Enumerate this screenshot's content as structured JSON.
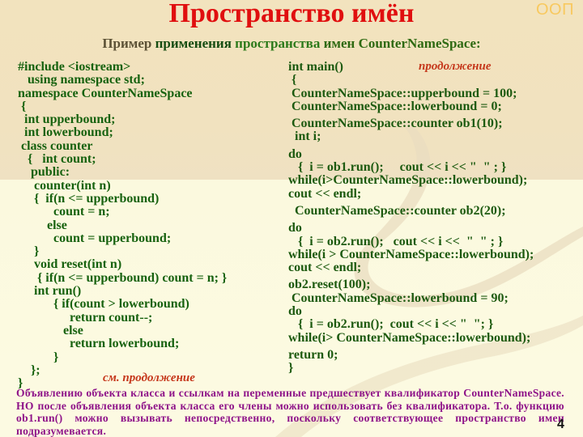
{
  "header": {
    "tag": "ООП",
    "title": "Пространство имён",
    "subtitle": {
      "part1": "Пример ",
      "part2": "применения ",
      "part3": "пространства ",
      "part4": "имен CounterNameSpace:"
    }
  },
  "colors": {
    "title": "#e00f0f",
    "code": "#17620f",
    "continuation": "#c5361a",
    "note": "#8e1389",
    "tag": "#f8c95f",
    "background_top": "#f2e3be",
    "background_bottom": "#fbf9de"
  },
  "left_code": {
    "lines": [
      "#include <iostream>",
      "   using namespace std;",
      "namespace CounterNameSpace",
      " {",
      "  int upperbound;",
      "  int lowerbound;",
      " class counter",
      "   {   int count;",
      "    public:",
      "     counter(int n)",
      "     {  if(n <= upperbound)",
      "           count = n;",
      "         else",
      "           count = upperbound;",
      "     }",
      "     void reset(int n)",
      "      { if(n <= upperbound) count = n; }",
      "     int run()",
      "           { if(count > lowerbound)",
      "                return count--;",
      "              else",
      "                return lowerbound;",
      "           }",
      "    };",
      "}"
    ],
    "continuation": "см. продолжение"
  },
  "right_code": {
    "continuation": "продолжение",
    "groups": [
      [
        "int main()",
        " {",
        " CounterNameSpace::upperbound = 100;",
        " CounterNameSpace::lowerbound = 0;"
      ],
      [
        " CounterNameSpace::counter ob1(10);",
        "  int i;"
      ],
      [
        "do",
        "   {  i = ob1.run();     cout << i << \"  \" ; }",
        "while(i>CounterNameSpace::lowerbound);",
        "cout << endl;"
      ],
      [
        "  CounterNameSpace::counter ob2(20);"
      ],
      [
        "do",
        "   {  i = ob2.run();   cout << i <<  \"  \" ; }",
        "while(i > CounterNameSpace::lowerbound);",
        "cout << endl;"
      ],
      [
        "ob2.reset(100);",
        " CounterNameSpace::lowerbound = 90;",
        "do",
        "   {  i = ob2.run();  cout << i << \"  \"; }",
        "while(i> CounterNameSpace::lowerbound);"
      ],
      [
        "return 0;",
        "}"
      ]
    ]
  },
  "note": "Объявлению объекта класса и ссылкам на переменные предшествует квалификатор CounterNameSpace. НО после объявления объекта класса его члены можно использовать без квалификатора. Т.о. функцию ob1.run() можно вызывать непосредственно, поскольку соответствующее пространство имен подразумевается.",
  "page_number": "4"
}
